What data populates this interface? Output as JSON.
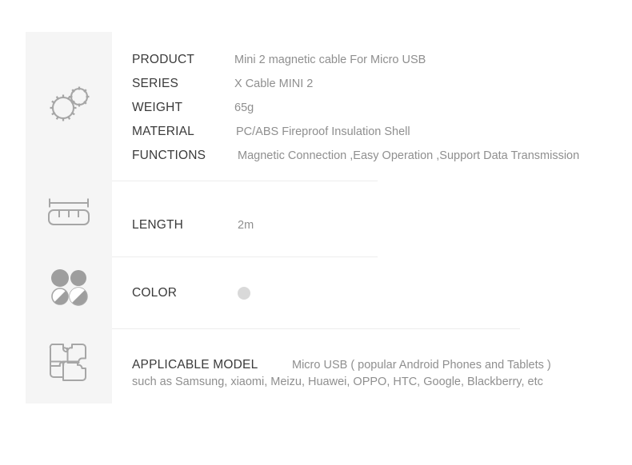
{
  "sections": [
    {
      "id": "product",
      "icon": "gears-icon",
      "specs": [
        {
          "label": "PRODUCT",
          "value": "Mini 2 magnetic cable For Micro USB"
        },
        {
          "label": "SERIES",
          "value": "X Cable MINI 2"
        },
        {
          "label": "WEIGHT",
          "value": "65g"
        },
        {
          "label": "MATERIAL",
          "value": "PC/ABS Fireproof Insulation Shell"
        },
        {
          "label": "FUNCTIONS",
          "value": "Magnetic Connection ,Easy Operation ,Support Data Transmission"
        }
      ]
    },
    {
      "id": "length",
      "icon": "ruler-icon",
      "specs": [
        {
          "label": "LENGTH",
          "value": "2m"
        }
      ]
    },
    {
      "id": "color",
      "icon": "color-circles-icon",
      "specs": [
        {
          "label": "COLOR",
          "value": ""
        }
      ],
      "swatch_color": "#d9d9d9"
    },
    {
      "id": "applicable-model",
      "icon": "puzzle-icon",
      "label": "APPLICABLE MODEL",
      "value": "Micro USB ( popular Android Phones and Tablets )",
      "sub_line": "such as Samsung, xiaomi, Meizu, Huawei, OPPO, HTC, Google, Blackberry, etc"
    }
  ],
  "theme": {
    "panel_background": "#f5f5f5",
    "label_color": "#3a3a3a",
    "value_color": "#8f8f8f",
    "icon_color": "#a6a6a6",
    "divider_color": "#ededed",
    "page_background": "#ffffff"
  }
}
